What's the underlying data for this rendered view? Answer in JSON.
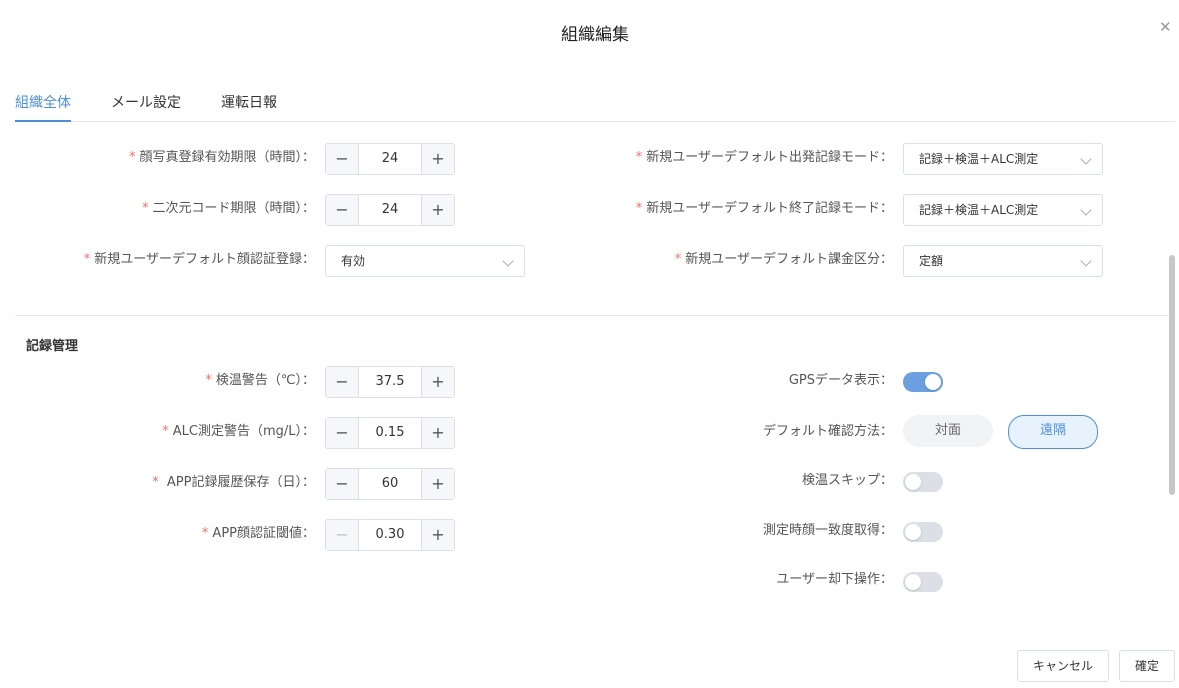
{
  "dialog": {
    "title": "組織編集",
    "close_icon": "close-icon"
  },
  "tabs": [
    {
      "label": "組織全体",
      "active": true
    },
    {
      "label": "メール設定",
      "active": false
    },
    {
      "label": "運転日報",
      "active": false
    }
  ],
  "general": {
    "face_photo_expiry": {
      "label": "顔写真登録有効期限（時間）：",
      "value": "24",
      "required": true
    },
    "qr_expiry": {
      "label": "二次元コード期限（時間）：",
      "value": "24",
      "required": true
    },
    "default_face_auth": {
      "label": "新規ユーザーデフォルト顔認証登録：",
      "value": "有効",
      "required": true
    },
    "default_start_mode": {
      "label": "新規ユーザーデフォルト出発記録モード：",
      "value": "記録＋検温＋ALC測定",
      "required": true
    },
    "default_end_mode": {
      "label": "新規ユーザーデフォルト終了記録モード：",
      "value": "記録＋検温＋ALC測定",
      "required": true
    },
    "default_billing": {
      "label": "新規ユーザーデフォルト課金区分：",
      "value": "定額",
      "required": true
    }
  },
  "records": {
    "section_title": "記録管理",
    "temp_warning": {
      "label": "検温警告（℃）：",
      "value": "37.5",
      "required": true
    },
    "alc_warning": {
      "label": "ALC測定警告（mg/L）：",
      "value": "0.15",
      "required": true
    },
    "app_history": {
      "label": " APP記録履歴保存（日）：",
      "value": "60",
      "required": true
    },
    "app_face_threshold": {
      "label": "APP顔認証閾値：",
      "value": "0.30",
      "required": true
    },
    "gps_display": {
      "label": "GPSデータ表示：",
      "on": true
    },
    "confirm_method": {
      "label": "デフォルト確認方法：",
      "options": [
        "対面",
        "遠隔"
      ],
      "selected": "遠隔"
    },
    "temp_skip": {
      "label": "検温スキップ：",
      "on": false
    },
    "face_match": {
      "label": "測定時顔一致度取得：",
      "on": false
    },
    "user_reject": {
      "label": "ユーザー却下操作：",
      "on": false
    }
  },
  "footer": {
    "cancel_label": "キャンセル",
    "confirm_label": "確定"
  },
  "colors": {
    "accent": "#4d8fd6",
    "required": "#f56c6c",
    "toggle_on": "#6b9fe0"
  }
}
